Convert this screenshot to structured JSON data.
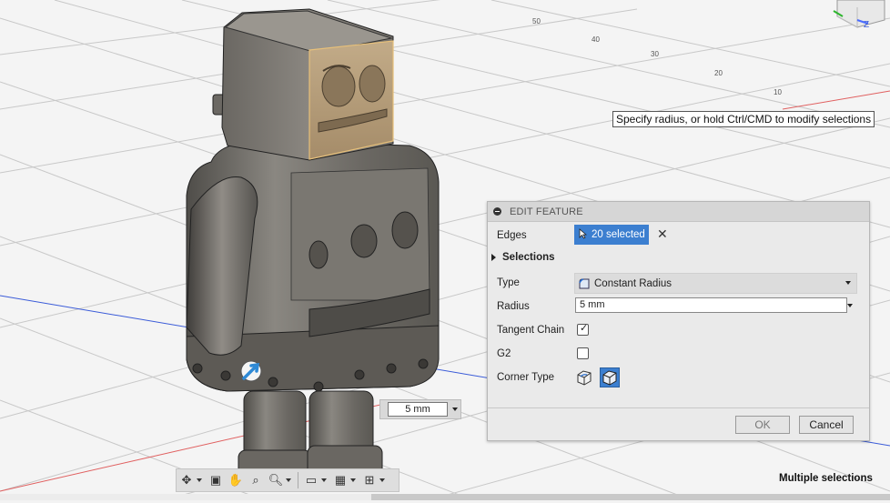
{
  "tooltip": "Specify radius, or hold Ctrl/CMD to modify selections",
  "dialog": {
    "title": "EDIT FEATURE",
    "edges_label": "Edges",
    "edges_selected": "20 selected",
    "selections_label": "Selections",
    "type_label": "Type",
    "type_value": "Constant Radius",
    "radius_label": "Radius",
    "radius_value": "5 mm",
    "tangent_chain_label": "Tangent Chain",
    "tangent_chain_checked": true,
    "g2_label": "G2",
    "g2_checked": false,
    "corner_type_label": "Corner Type",
    "ok_label": "OK",
    "cancel_label": "Cancel"
  },
  "floating_input": {
    "value": "5 mm"
  },
  "status": "Multiple selections",
  "viewcube_axis": "Z",
  "nav_icons": [
    "orbit-icon",
    "look-at-icon",
    "pan-icon",
    "zoom-window-icon",
    "zoom-icon",
    "display-settings-icon",
    "grid-icon",
    "viewports-icon"
  ],
  "colors": {
    "selection_blue": "#3c7fd0",
    "model_gray": "#6e6b66",
    "selected_face": "#b59b78"
  }
}
